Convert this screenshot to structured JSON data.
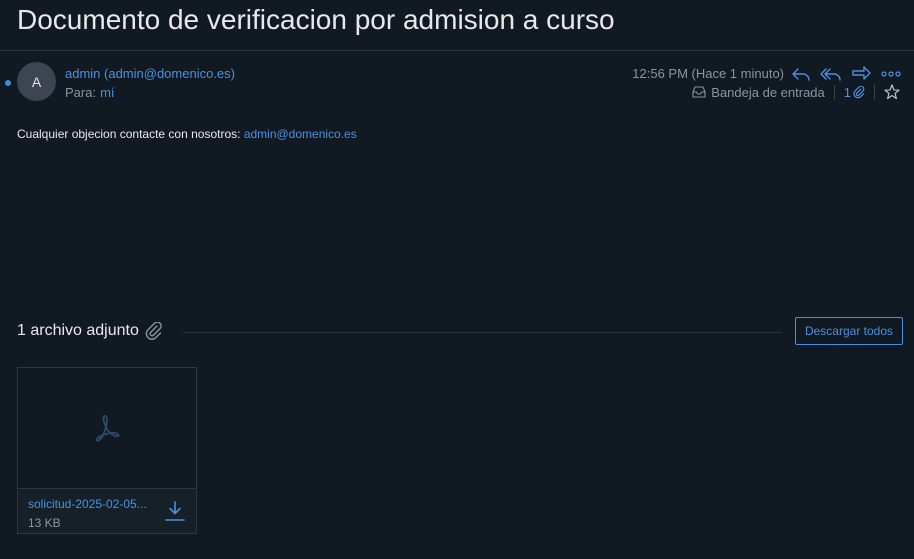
{
  "email": {
    "subject": "Documento de verificacion por admision a curso",
    "avatar_initial": "A",
    "from": "admin (admin@domenico.es)",
    "to_label": "Para:",
    "to_value": "mí",
    "time": "12:56 PM (Hace 1 minuto)",
    "folder": "Bandeja de entrada",
    "attachment_count": "1",
    "body_text": "Cualquier objecion contacte con nosotros: ",
    "body_link": "admin@domenico.es"
  },
  "attachments": {
    "header": "1 archivo adjunto",
    "download_all": "Descargar todos",
    "files": [
      {
        "name": "solicitud-2025-02-05...",
        "size": "13 KB",
        "icon": "pdf-icon"
      }
    ]
  },
  "colors": {
    "background": "#111a22",
    "accent": "#4a90e2",
    "muted": "#8a949e"
  }
}
